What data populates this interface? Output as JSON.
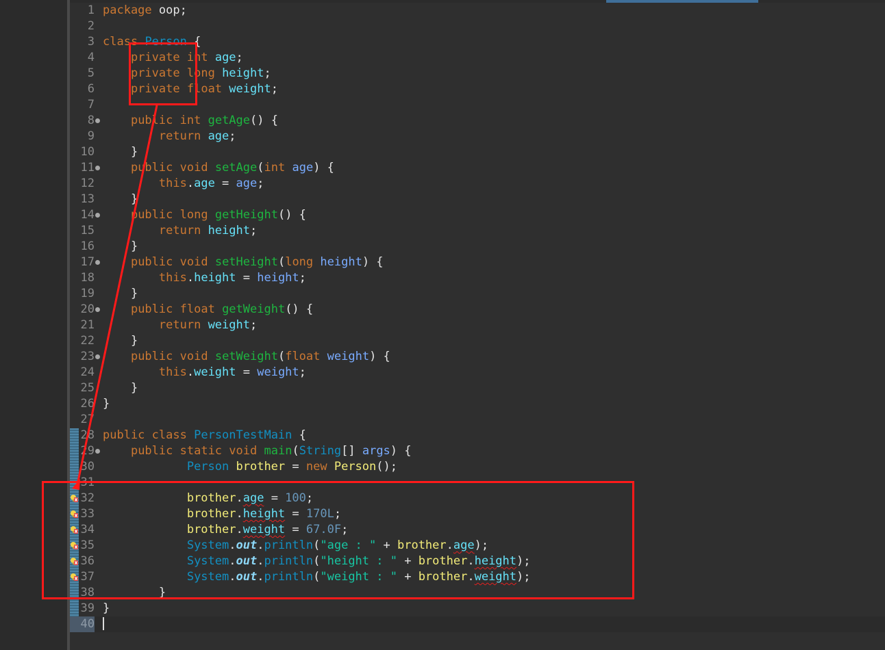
{
  "editor": {
    "lines": [
      {
        "n": "1",
        "tokens": [
          {
            "t": "package",
            "c": "k"
          },
          {
            "t": " oop;",
            "c": "pu"
          }
        ]
      },
      {
        "n": "2",
        "tokens": []
      },
      {
        "n": "3",
        "tokens": [
          {
            "t": "class",
            "c": "k"
          },
          {
            "t": " ",
            "c": "pu"
          },
          {
            "t": "Person",
            "c": "cls"
          },
          {
            "t": " {",
            "c": "pu"
          }
        ]
      },
      {
        "n": "4",
        "tokens": [
          {
            "t": "    ",
            "c": "pu"
          },
          {
            "t": "private",
            "c": "k"
          },
          {
            "t": " ",
            "c": "pu"
          },
          {
            "t": "int",
            "c": "t"
          },
          {
            "t": " ",
            "c": "pu"
          },
          {
            "t": "age",
            "c": "fld"
          },
          {
            "t": ";",
            "c": "pu"
          }
        ]
      },
      {
        "n": "5",
        "tokens": [
          {
            "t": "    ",
            "c": "pu"
          },
          {
            "t": "private",
            "c": "k"
          },
          {
            "t": " ",
            "c": "pu"
          },
          {
            "t": "long",
            "c": "t"
          },
          {
            "t": " ",
            "c": "pu"
          },
          {
            "t": "height",
            "c": "fld"
          },
          {
            "t": ";",
            "c": "pu"
          }
        ]
      },
      {
        "n": "6",
        "tokens": [
          {
            "t": "    ",
            "c": "pu"
          },
          {
            "t": "private",
            "c": "k"
          },
          {
            "t": " ",
            "c": "pu"
          },
          {
            "t": "float",
            "c": "t"
          },
          {
            "t": " ",
            "c": "pu"
          },
          {
            "t": "weight",
            "c": "fld"
          },
          {
            "t": ";",
            "c": "pu"
          }
        ]
      },
      {
        "n": "7",
        "tokens": []
      },
      {
        "n": "8",
        "fold": true,
        "tokens": [
          {
            "t": "    ",
            "c": "pu"
          },
          {
            "t": "public",
            "c": "k"
          },
          {
            "t": " ",
            "c": "pu"
          },
          {
            "t": "int",
            "c": "t"
          },
          {
            "t": " ",
            "c": "pu"
          },
          {
            "t": "getAge",
            "c": "mth"
          },
          {
            "t": "() {",
            "c": "pu"
          }
        ]
      },
      {
        "n": "9",
        "tokens": [
          {
            "t": "        ",
            "c": "pu"
          },
          {
            "t": "return",
            "c": "k"
          },
          {
            "t": " ",
            "c": "pu"
          },
          {
            "t": "age",
            "c": "fld"
          },
          {
            "t": ";",
            "c": "pu"
          }
        ]
      },
      {
        "n": "10",
        "tokens": [
          {
            "t": "    }",
            "c": "pu"
          }
        ]
      },
      {
        "n": "11",
        "fold": true,
        "tokens": [
          {
            "t": "    ",
            "c": "pu"
          },
          {
            "t": "public",
            "c": "k"
          },
          {
            "t": " ",
            "c": "pu"
          },
          {
            "t": "void",
            "c": "t"
          },
          {
            "t": " ",
            "c": "pu"
          },
          {
            "t": "setAge",
            "c": "mth"
          },
          {
            "t": "(",
            "c": "pu"
          },
          {
            "t": "int",
            "c": "t"
          },
          {
            "t": " ",
            "c": "pu"
          },
          {
            "t": "age",
            "c": "par"
          },
          {
            "t": ") {",
            "c": "pu"
          }
        ]
      },
      {
        "n": "12",
        "tokens": [
          {
            "t": "        ",
            "c": "pu"
          },
          {
            "t": "this",
            "c": "k"
          },
          {
            "t": ".",
            "c": "pu"
          },
          {
            "t": "age",
            "c": "fld"
          },
          {
            "t": " = ",
            "c": "pu"
          },
          {
            "t": "age",
            "c": "par"
          },
          {
            "t": ";",
            "c": "pu"
          }
        ]
      },
      {
        "n": "13",
        "tokens": [
          {
            "t": "    }",
            "c": "pu"
          }
        ]
      },
      {
        "n": "14",
        "fold": true,
        "tokens": [
          {
            "t": "    ",
            "c": "pu"
          },
          {
            "t": "public",
            "c": "k"
          },
          {
            "t": " ",
            "c": "pu"
          },
          {
            "t": "long",
            "c": "t"
          },
          {
            "t": " ",
            "c": "pu"
          },
          {
            "t": "getHeight",
            "c": "mth"
          },
          {
            "t": "() {",
            "c": "pu"
          }
        ]
      },
      {
        "n": "15",
        "tokens": [
          {
            "t": "        ",
            "c": "pu"
          },
          {
            "t": "return",
            "c": "k"
          },
          {
            "t": " ",
            "c": "pu"
          },
          {
            "t": "height",
            "c": "fld"
          },
          {
            "t": ";",
            "c": "pu"
          }
        ]
      },
      {
        "n": "16",
        "tokens": [
          {
            "t": "    }",
            "c": "pu"
          }
        ]
      },
      {
        "n": "17",
        "fold": true,
        "tokens": [
          {
            "t": "    ",
            "c": "pu"
          },
          {
            "t": "public",
            "c": "k"
          },
          {
            "t": " ",
            "c": "pu"
          },
          {
            "t": "void",
            "c": "t"
          },
          {
            "t": " ",
            "c": "pu"
          },
          {
            "t": "setHeight",
            "c": "mth"
          },
          {
            "t": "(",
            "c": "pu"
          },
          {
            "t": "long",
            "c": "t"
          },
          {
            "t": " ",
            "c": "pu"
          },
          {
            "t": "height",
            "c": "par"
          },
          {
            "t": ") {",
            "c": "pu"
          }
        ]
      },
      {
        "n": "18",
        "tokens": [
          {
            "t": "        ",
            "c": "pu"
          },
          {
            "t": "this",
            "c": "k"
          },
          {
            "t": ".",
            "c": "pu"
          },
          {
            "t": "height",
            "c": "fld"
          },
          {
            "t": " = ",
            "c": "pu"
          },
          {
            "t": "height",
            "c": "par"
          },
          {
            "t": ";",
            "c": "pu"
          }
        ]
      },
      {
        "n": "19",
        "tokens": [
          {
            "t": "    }",
            "c": "pu"
          }
        ]
      },
      {
        "n": "20",
        "fold": true,
        "tokens": [
          {
            "t": "    ",
            "c": "pu"
          },
          {
            "t": "public",
            "c": "k"
          },
          {
            "t": " ",
            "c": "pu"
          },
          {
            "t": "float",
            "c": "t"
          },
          {
            "t": " ",
            "c": "pu"
          },
          {
            "t": "getWeight",
            "c": "mth"
          },
          {
            "t": "() {",
            "c": "pu"
          }
        ]
      },
      {
        "n": "21",
        "tokens": [
          {
            "t": "        ",
            "c": "pu"
          },
          {
            "t": "return",
            "c": "k"
          },
          {
            "t": " ",
            "c": "pu"
          },
          {
            "t": "weight",
            "c": "fld"
          },
          {
            "t": ";",
            "c": "pu"
          }
        ]
      },
      {
        "n": "22",
        "tokens": [
          {
            "t": "    }",
            "c": "pu"
          }
        ]
      },
      {
        "n": "23",
        "fold": true,
        "tokens": [
          {
            "t": "    ",
            "c": "pu"
          },
          {
            "t": "public",
            "c": "k"
          },
          {
            "t": " ",
            "c": "pu"
          },
          {
            "t": "void",
            "c": "t"
          },
          {
            "t": " ",
            "c": "pu"
          },
          {
            "t": "setWeight",
            "c": "mth"
          },
          {
            "t": "(",
            "c": "pu"
          },
          {
            "t": "float",
            "c": "t"
          },
          {
            "t": " ",
            "c": "pu"
          },
          {
            "t": "weight",
            "c": "par"
          },
          {
            "t": ") {",
            "c": "pu"
          }
        ]
      },
      {
        "n": "24",
        "tokens": [
          {
            "t": "        ",
            "c": "pu"
          },
          {
            "t": "this",
            "c": "k"
          },
          {
            "t": ".",
            "c": "pu"
          },
          {
            "t": "weight",
            "c": "fld"
          },
          {
            "t": " = ",
            "c": "pu"
          },
          {
            "t": "weight",
            "c": "par"
          },
          {
            "t": ";",
            "c": "pu"
          }
        ]
      },
      {
        "n": "25",
        "tokens": [
          {
            "t": "    }",
            "c": "pu"
          }
        ]
      },
      {
        "n": "26",
        "tokens": [
          {
            "t": "}",
            "c": "pu"
          }
        ]
      },
      {
        "n": "27",
        "tokens": []
      },
      {
        "n": "28",
        "tokens": [
          {
            "t": "public",
            "c": "k"
          },
          {
            "t": " ",
            "c": "pu"
          },
          {
            "t": "class",
            "c": "k"
          },
          {
            "t": " ",
            "c": "pu"
          },
          {
            "t": "PersonTestMain",
            "c": "cls"
          },
          {
            "t": " {",
            "c": "pu"
          }
        ]
      },
      {
        "n": "29",
        "fold": true,
        "tokens": [
          {
            "t": "    ",
            "c": "pu"
          },
          {
            "t": "public",
            "c": "k"
          },
          {
            "t": " ",
            "c": "pu"
          },
          {
            "t": "static",
            "c": "k"
          },
          {
            "t": " ",
            "c": "pu"
          },
          {
            "t": "void",
            "c": "t"
          },
          {
            "t": " ",
            "c": "pu"
          },
          {
            "t": "main",
            "c": "mth"
          },
          {
            "t": "(",
            "c": "pu"
          },
          {
            "t": "String",
            "c": "cls"
          },
          {
            "t": "[] ",
            "c": "pu"
          },
          {
            "t": "args",
            "c": "par"
          },
          {
            "t": ") {",
            "c": "pu"
          }
        ]
      },
      {
        "n": "30",
        "tokens": [
          {
            "t": "            ",
            "c": "pu"
          },
          {
            "t": "Person",
            "c": "cls"
          },
          {
            "t": " ",
            "c": "pu"
          },
          {
            "t": "brother",
            "c": "loc"
          },
          {
            "t": " = ",
            "c": "pu"
          },
          {
            "t": "new",
            "c": "k"
          },
          {
            "t": " ",
            "c": "pu"
          },
          {
            "t": "Person",
            "c": "loc"
          },
          {
            "t": "();",
            "c": "pu"
          }
        ]
      },
      {
        "n": "31",
        "tokens": []
      },
      {
        "n": "32",
        "err": true,
        "tokens": [
          {
            "t": "            ",
            "c": "pu"
          },
          {
            "t": "brother",
            "c": "loc"
          },
          {
            "t": ".",
            "c": "pu"
          },
          {
            "t": "age",
            "c": "fld",
            "sq": true
          },
          {
            "t": " = ",
            "c": "pu"
          },
          {
            "t": "100",
            "c": "num"
          },
          {
            "t": ";",
            "c": "pu"
          }
        ]
      },
      {
        "n": "33",
        "err": true,
        "tokens": [
          {
            "t": "            ",
            "c": "pu"
          },
          {
            "t": "brother",
            "c": "loc"
          },
          {
            "t": ".",
            "c": "pu"
          },
          {
            "t": "height",
            "c": "fld",
            "sq": true
          },
          {
            "t": " = ",
            "c": "pu"
          },
          {
            "t": "170L",
            "c": "num"
          },
          {
            "t": ";",
            "c": "pu"
          }
        ]
      },
      {
        "n": "34",
        "err": true,
        "tokens": [
          {
            "t": "            ",
            "c": "pu"
          },
          {
            "t": "brother",
            "c": "loc"
          },
          {
            "t": ".",
            "c": "pu"
          },
          {
            "t": "weight",
            "c": "fld",
            "sq": true
          },
          {
            "t": " = ",
            "c": "pu"
          },
          {
            "t": "67.0F",
            "c": "num"
          },
          {
            "t": ";",
            "c": "pu"
          }
        ]
      },
      {
        "n": "35",
        "err": true,
        "tokens": [
          {
            "t": "            ",
            "c": "pu"
          },
          {
            "t": "System",
            "c": "cls"
          },
          {
            "t": ".",
            "c": "pu"
          },
          {
            "t": "out",
            "c": "sf"
          },
          {
            "t": ".",
            "c": "pu"
          },
          {
            "t": "println",
            "c": "cls"
          },
          {
            "t": "(",
            "c": "pu"
          },
          {
            "t": "\"age : \"",
            "c": "str"
          },
          {
            "t": " + ",
            "c": "pu"
          },
          {
            "t": "brother",
            "c": "loc"
          },
          {
            "t": ".",
            "c": "pu"
          },
          {
            "t": "age",
            "c": "fld",
            "sq": true
          },
          {
            "t": ");",
            "c": "pu"
          }
        ]
      },
      {
        "n": "36",
        "err": true,
        "tokens": [
          {
            "t": "            ",
            "c": "pu"
          },
          {
            "t": "System",
            "c": "cls"
          },
          {
            "t": ".",
            "c": "pu"
          },
          {
            "t": "out",
            "c": "sf"
          },
          {
            "t": ".",
            "c": "pu"
          },
          {
            "t": "println",
            "c": "cls"
          },
          {
            "t": "(",
            "c": "pu"
          },
          {
            "t": "\"height : \"",
            "c": "str"
          },
          {
            "t": " + ",
            "c": "pu"
          },
          {
            "t": "brother",
            "c": "loc"
          },
          {
            "t": ".",
            "c": "pu"
          },
          {
            "t": "height",
            "c": "fld",
            "sq": true
          },
          {
            "t": ");",
            "c": "pu"
          }
        ]
      },
      {
        "n": "37",
        "err": true,
        "tokens": [
          {
            "t": "            ",
            "c": "pu"
          },
          {
            "t": "System",
            "c": "cls"
          },
          {
            "t": ".",
            "c": "pu"
          },
          {
            "t": "out",
            "c": "sf"
          },
          {
            "t": ".",
            "c": "pu"
          },
          {
            "t": "println",
            "c": "cls"
          },
          {
            "t": "(",
            "c": "pu"
          },
          {
            "t": "\"weight : \"",
            "c": "str"
          },
          {
            "t": " + ",
            "c": "pu"
          },
          {
            "t": "brother",
            "c": "loc"
          },
          {
            "t": ".",
            "c": "pu"
          },
          {
            "t": "weight",
            "c": "fld",
            "sq": true
          },
          {
            "t": ");",
            "c": "pu"
          }
        ]
      },
      {
        "n": "38",
        "tokens": [
          {
            "t": "        }",
            "c": "pu"
          }
        ]
      },
      {
        "n": "39",
        "tokens": [
          {
            "t": "}",
            "c": "pu"
          }
        ]
      },
      {
        "n": "40",
        "current": true,
        "tokens": []
      }
    ]
  },
  "colors": {
    "editor_background": "#2f2f2f",
    "keyword": "#cc7832",
    "class_name": "#1290c3",
    "field": "#66e1f8",
    "method": "#1eb540",
    "parameter": "#79abff",
    "local_variable": "#f3ec79",
    "number": "#6897bb",
    "string": "#17c6a3",
    "annotation_red": "#ff1a1a"
  },
  "icons": {
    "fold_marker": "collapse-circle-icon",
    "error_marker": "error-lightbulb-icon"
  }
}
